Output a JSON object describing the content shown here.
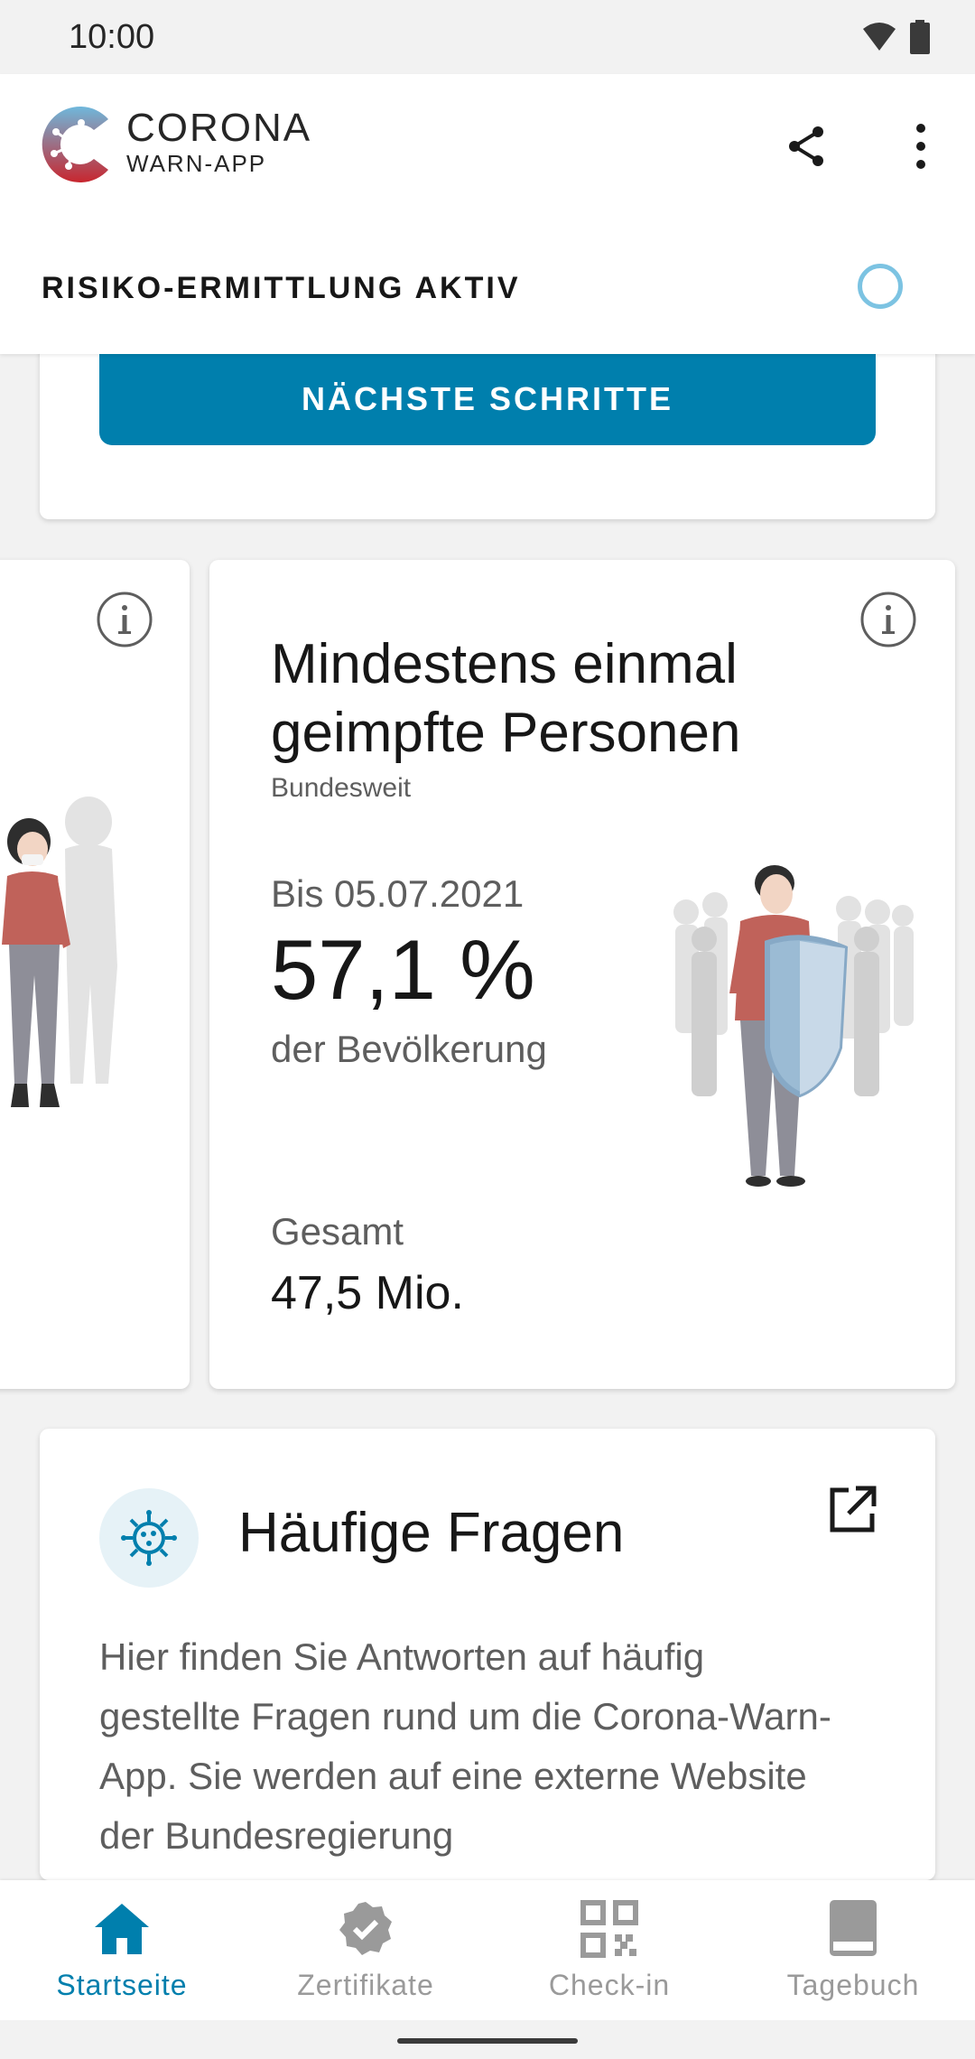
{
  "status_bar": {
    "time": "10:00"
  },
  "header": {
    "logo_title": "CORONA",
    "logo_subtitle": "WARN-APP",
    "risk_status": "RISIKO-ERMITTLUNG AKTIV"
  },
  "top_card": {
    "next_steps_label": "NÄCHSTE SCHRITTE"
  },
  "vaccination_card": {
    "title": "Mindestens einmal geimpfte Personen",
    "subtitle": "Bundesweit",
    "date_label": "Bis 05.07.2021",
    "value": "57,1 %",
    "value_caption": "der Bevölkerung",
    "total_label": "Gesamt",
    "total_value": "47,5 Mio."
  },
  "faq_card": {
    "title": "Häufige Fragen",
    "body": "Hier finden Sie Antworten auf häufig gestellte Fragen rund um die Corona-Warn-App. Sie werden auf eine externe Website der Bundesregierung"
  },
  "bottom_nav": {
    "items": [
      {
        "label": "Startseite",
        "icon": "home-icon",
        "active": true
      },
      {
        "label": "Zertifikate",
        "icon": "certificate-icon",
        "active": false
      },
      {
        "label": "Check-in",
        "icon": "qr-code-icon",
        "active": false
      },
      {
        "label": "Tagebuch",
        "icon": "diary-icon",
        "active": false
      }
    ]
  },
  "colors": {
    "accent": "#007fad",
    "risk_indicator": "#7cc3e2",
    "muted_text": "#5e5e5e",
    "inactive_nav": "#9a9a9a"
  }
}
